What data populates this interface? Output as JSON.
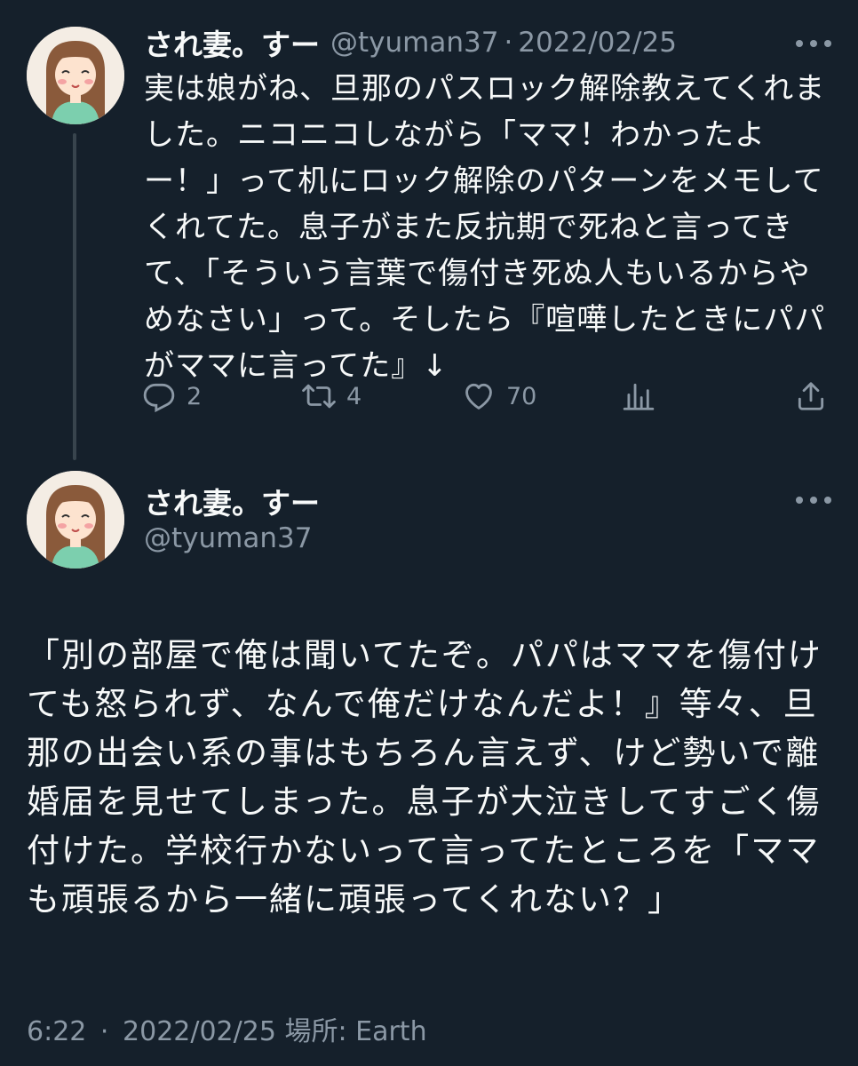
{
  "tweet1": {
    "display_name": "され妻。すー",
    "handle": "@tyuman37",
    "separator": "·",
    "date": "2022/02/25",
    "text": "実は娘がね、旦那のパスロック解除教えてくれま\nした。ニコニコしながら「ママ！わかったよ\nー！」って机にロック解除のパターンをメモして\nくれてた。息子がまた反抗期で死ねと言ってき\nて、「そういう言葉で傷付き死ぬ人もいるからや\nめなさい」って。そしたら『喧嘩したときにパパ\nがママに言ってた』↓",
    "actions": [
      {
        "icon": "reply-icon",
        "count": "2"
      },
      {
        "icon": "retweet-icon",
        "count": "4"
      },
      {
        "icon": "like-icon",
        "count": "70"
      },
      {
        "icon": "analytics-icon",
        "count": ""
      },
      {
        "icon": "share-icon",
        "count": ""
      }
    ]
  },
  "tweet2": {
    "display_name": "され妻。すー",
    "handle": "@tyuman37",
    "text": "「別の部屋で俺は聞いてたぞ。パパはママを傷付け\nても怒られず、なんで俺だけなんだよ！』等々、旦\n那の出会い系の事はもちろん言えず、けど勢いで離\n婚届を見せてしまった。息子が大泣きしてすごく傷\n付けた。学校行かないって言ってたところを「ママ\nも頑張るから一緒に頑張ってくれない？」",
    "time": "6:22",
    "separator": "·",
    "date": "2022/02/25",
    "location_label": "場所: Earth"
  },
  "colors": {
    "background": "#15202b",
    "text": "#f7f9f9",
    "secondary": "#8b98a5",
    "thread_line": "#38444d"
  }
}
